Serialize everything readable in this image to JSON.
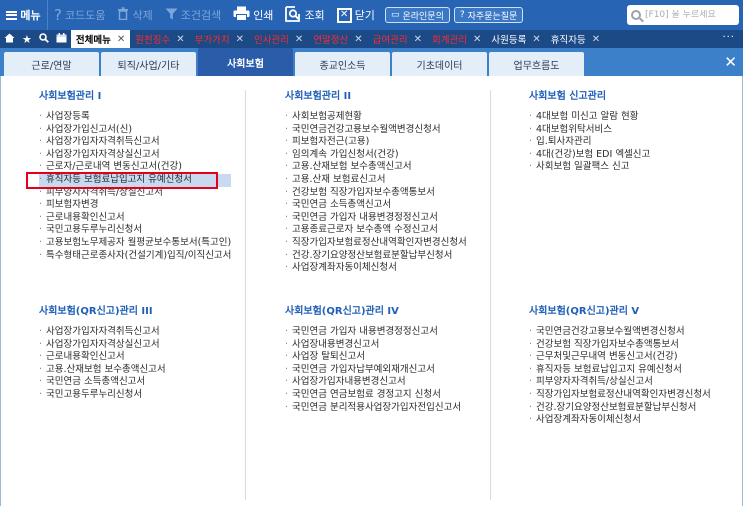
{
  "toolbar": {
    "menu_label": "메뉴",
    "buttons": [
      {
        "label": "코드도움",
        "icon": "help-icon",
        "enabled": false
      },
      {
        "label": "삭제",
        "icon": "trash-icon",
        "enabled": false
      },
      {
        "label": "조건검색",
        "icon": "filter-icon",
        "enabled": false
      },
      {
        "label": "인쇄",
        "icon": "printer-icon",
        "enabled": true
      },
      {
        "label": "조회",
        "icon": "search-doc-icon",
        "enabled": true
      },
      {
        "label": "닫기",
        "icon": "close-box-icon",
        "enabled": true
      }
    ],
    "online_inquiry": "온라인문의",
    "faq": "자주묻는질문",
    "search_placeholder": "[F10] 을 누르세요"
  },
  "open_tabs": [
    {
      "label": "전체메뉴",
      "style": "active"
    },
    {
      "label": "원천징수",
      "style": "red"
    },
    {
      "label": "부가가치",
      "style": "red"
    },
    {
      "label": "인사관리",
      "style": "red"
    },
    {
      "label": "연말정산",
      "style": "red"
    },
    {
      "label": "급여관리",
      "style": "red"
    },
    {
      "label": "회계관리",
      "style": "red"
    },
    {
      "label": "사원등록",
      "style": "normal"
    },
    {
      "label": "휴직자등",
      "style": "normal"
    }
  ],
  "categories": [
    "근로/연말",
    "퇴직/사업/기타",
    "사회보험",
    "종교인소득",
    "기초데이터",
    "업무흐름도"
  ],
  "active_category": "사회보험",
  "sections": [
    {
      "title": "사회보험관리 I",
      "items": [
        "사업장등록",
        "사업장가입신고서(신)",
        "사업장가입자자격취득신고서",
        "사업장가입자자격상실신고서",
        "근로자/근로내역 변동신고서(건강)",
        "휴직자등 보험료납입고지 유예신청서",
        "피부양자자격취득/상실신고서",
        "피보험자변경",
        "근로내용확인신고서",
        "국민고용두루누리신청서",
        "고용보험노무제공자 월평균보수통보서(특고인)",
        "특수형태근로종사자(건설기계)입직/이직신고서"
      ],
      "highlight_index": 5
    },
    {
      "title": "사회보험관리 II",
      "items": [
        "사회보험공제현황",
        "국민연금건강고용보수월액변경신청서",
        "피보험자전근(고용)",
        "임의계속 가입신청서(건강)",
        "고용.산재보험 보수총액신고서",
        "고용.산재 보험료신고서",
        "건강보험 직장가입자보수총액통보서",
        "국민연금 소득총액신고서",
        "국민연금 가입자 내용변경정정신고서",
        "고용종료근로자 보수총액 수정신고서",
        "직장가입자보험료정산내역확인자변경신청서",
        "건강.장기요양정산보험료분할납부신청서",
        "사업장계좌자동이체신청서"
      ]
    },
    {
      "title": "사회보험 신고관리",
      "items": [
        "4대보험 미신고 알람 현황",
        "4대보험위탁서비스",
        "입.퇴사자관리",
        "4대(건강)보험 EDI 엑셀신고",
        "사회보험 일괄팩스 신고"
      ]
    },
    {
      "title": "사회보험(QR신고)관리 III",
      "items": [
        "사업장가입자자격취득신고서",
        "사업장가입자자격상실신고서",
        "근로내용확인신고서",
        "고용.산재보험 보수총액신고서",
        "국민연금 소득총액신고서",
        "국민고용두루누리신청서"
      ]
    },
    {
      "title": "사회보험(QR신고)관리 IV",
      "items": [
        "국민연금 가입자 내용변경정정신고서",
        "사업장내용변경신고서",
        "사업장 탈퇴신고서",
        "국민연금 가입자납부예외재개신고서",
        "사업장가입자내용변경신고서",
        "국민연금 연금보험료 경정고지 신청서",
        "국민연금 분리적용사업장가입자전입신고서"
      ]
    },
    {
      "title": "사회보험(QR신고)관리 V",
      "items": [
        "국민연금건강고용보수월액변경신청서",
        "건강보험 직장가입자보수총액통보서",
        "근무처및근무내역 변동신고서(건강)",
        "휴직자등 보험료납입고지 유예신청서",
        "피부양자자격취득/상실신고서",
        "직장가입자보험료정산내역확인자변경신청서",
        "건강.장기요양정산보험료분할납부신청서",
        "사업장계좌자동이체신청서"
      ]
    }
  ]
}
